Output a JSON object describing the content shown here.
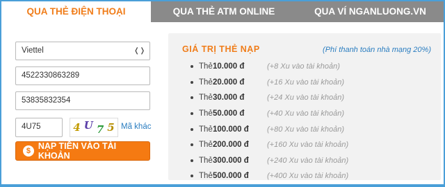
{
  "tabs": [
    {
      "label": "QUA THẺ ĐIỆN THOẠI",
      "active": true
    },
    {
      "label": "QUA THẺ ATM ONLINE",
      "active": false
    },
    {
      "label": "QUA VÍ NGANLUONG.VN",
      "active": false
    }
  ],
  "form": {
    "carrier": "Viettel",
    "card_number": "4522330863289",
    "serial": "53835832354",
    "captcha_value": "4U75",
    "captcha_chars": [
      "4",
      "U",
      "7",
      "5"
    ],
    "other_code": "Mã khác",
    "submit_label": "NẠP TIỀN VÀO TÀI KHOẢN",
    "submit_icon": "$"
  },
  "panel": {
    "title": "GIÁ TRỊ THẺ NẠP",
    "note": "(Phí thanh toán nhà mạng 20%)",
    "rate_prefix": "Thẻ",
    "rates": [
      {
        "value": "10.000 đ",
        "bonus": "(+8 Xu vào tài khoản)"
      },
      {
        "value": "20.000 đ",
        "bonus": "(+16 Xu vào tài khoản)"
      },
      {
        "value": "30.000 đ",
        "bonus": "(+24 Xu vào tài khoản)"
      },
      {
        "value": "50.000 đ",
        "bonus": "(+40 Xu vào tài khoản)"
      },
      {
        "value": "100.000 đ",
        "bonus": "(+80 Xu vào tài khoản)"
      },
      {
        "value": "200.000 đ",
        "bonus": "(+160 Xu vào tài khoản)"
      },
      {
        "value": "300.000 đ",
        "bonus": "(+240 Xu vào tài khoản)"
      },
      {
        "value": "500.000 đ",
        "bonus": "(+400 Xu vào tài khoản)"
      }
    ]
  },
  "colors": {
    "accent": "#f07d1a",
    "link": "#2a7dc0",
    "tab_inactive": "#8a8a8a",
    "border": "#4a9fd8"
  }
}
